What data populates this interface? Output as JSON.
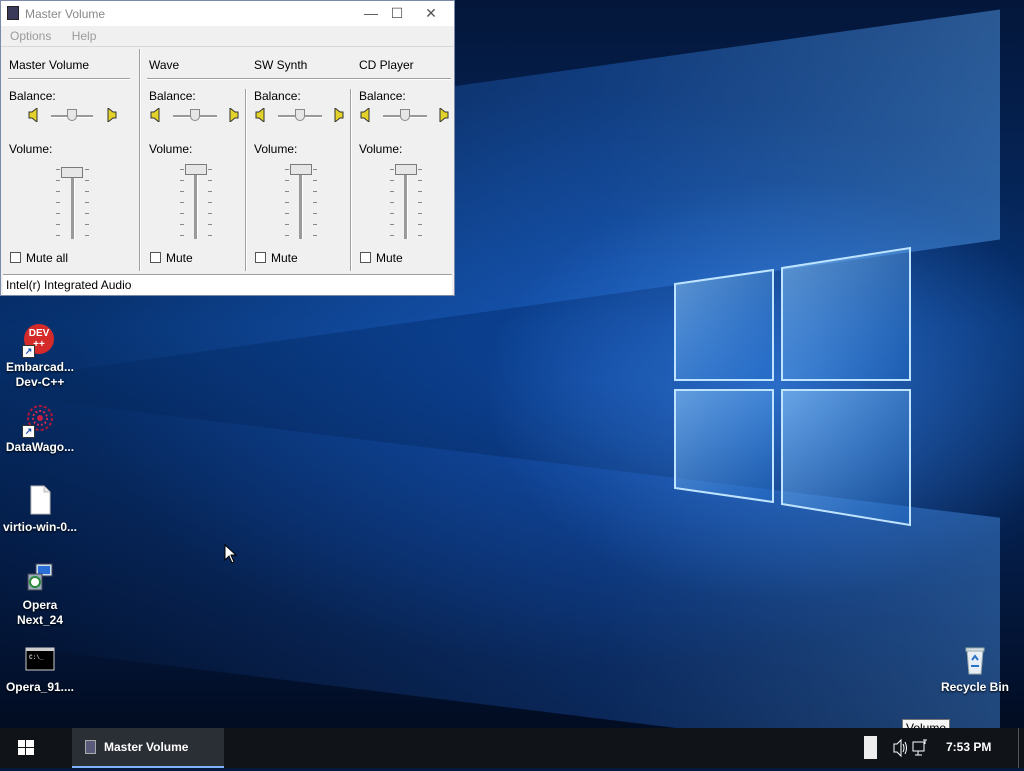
{
  "window": {
    "title": "Master Volume",
    "menu": [
      "Options",
      "Help"
    ],
    "status": "Intel(r) Integrated Audio",
    "channels": [
      {
        "name": "Master Volume",
        "balance_label": "Balance:",
        "volume_label": "Volume:",
        "mute_label": "Mute all",
        "muted": false
      },
      {
        "name": "Wave",
        "balance_label": "Balance:",
        "volume_label": "Volume:",
        "mute_label": "Mute",
        "muted": false
      },
      {
        "name": "SW Synth",
        "balance_label": "Balance:",
        "volume_label": "Volume:",
        "mute_label": "Mute",
        "muted": false
      },
      {
        "name": "CD Player",
        "balance_label": "Balance:",
        "volume_label": "Volume:",
        "mute_label": "Mute",
        "muted": false
      }
    ]
  },
  "desktop": {
    "icons": [
      {
        "label_line1": "Embarcad...",
        "label_line2": "Dev-C++",
        "badge": "DEV",
        "badge2": "++",
        "icon": "devcpp-icon"
      },
      {
        "label_line1": "DataWago...",
        "icon": "datawagon-icon"
      },
      {
        "label_line1": "virtio-win-0...",
        "icon": "file-icon"
      },
      {
        "label_line1": "Opera",
        "label_line2": "Next_24",
        "icon": "installer-icon"
      },
      {
        "label_line1": "Opera_91....",
        "icon": "console-icon"
      },
      {
        "label_line1": "Recycle Bin",
        "icon": "recycle-bin-icon"
      }
    ]
  },
  "taskbar": {
    "active_app": "Master Volume",
    "clock": "7:53 PM",
    "tooltip": "Volume"
  },
  "colors": {
    "taskbar": "#101318",
    "accent": "#7fb3ff",
    "window_bg": "#f0f0f0"
  }
}
